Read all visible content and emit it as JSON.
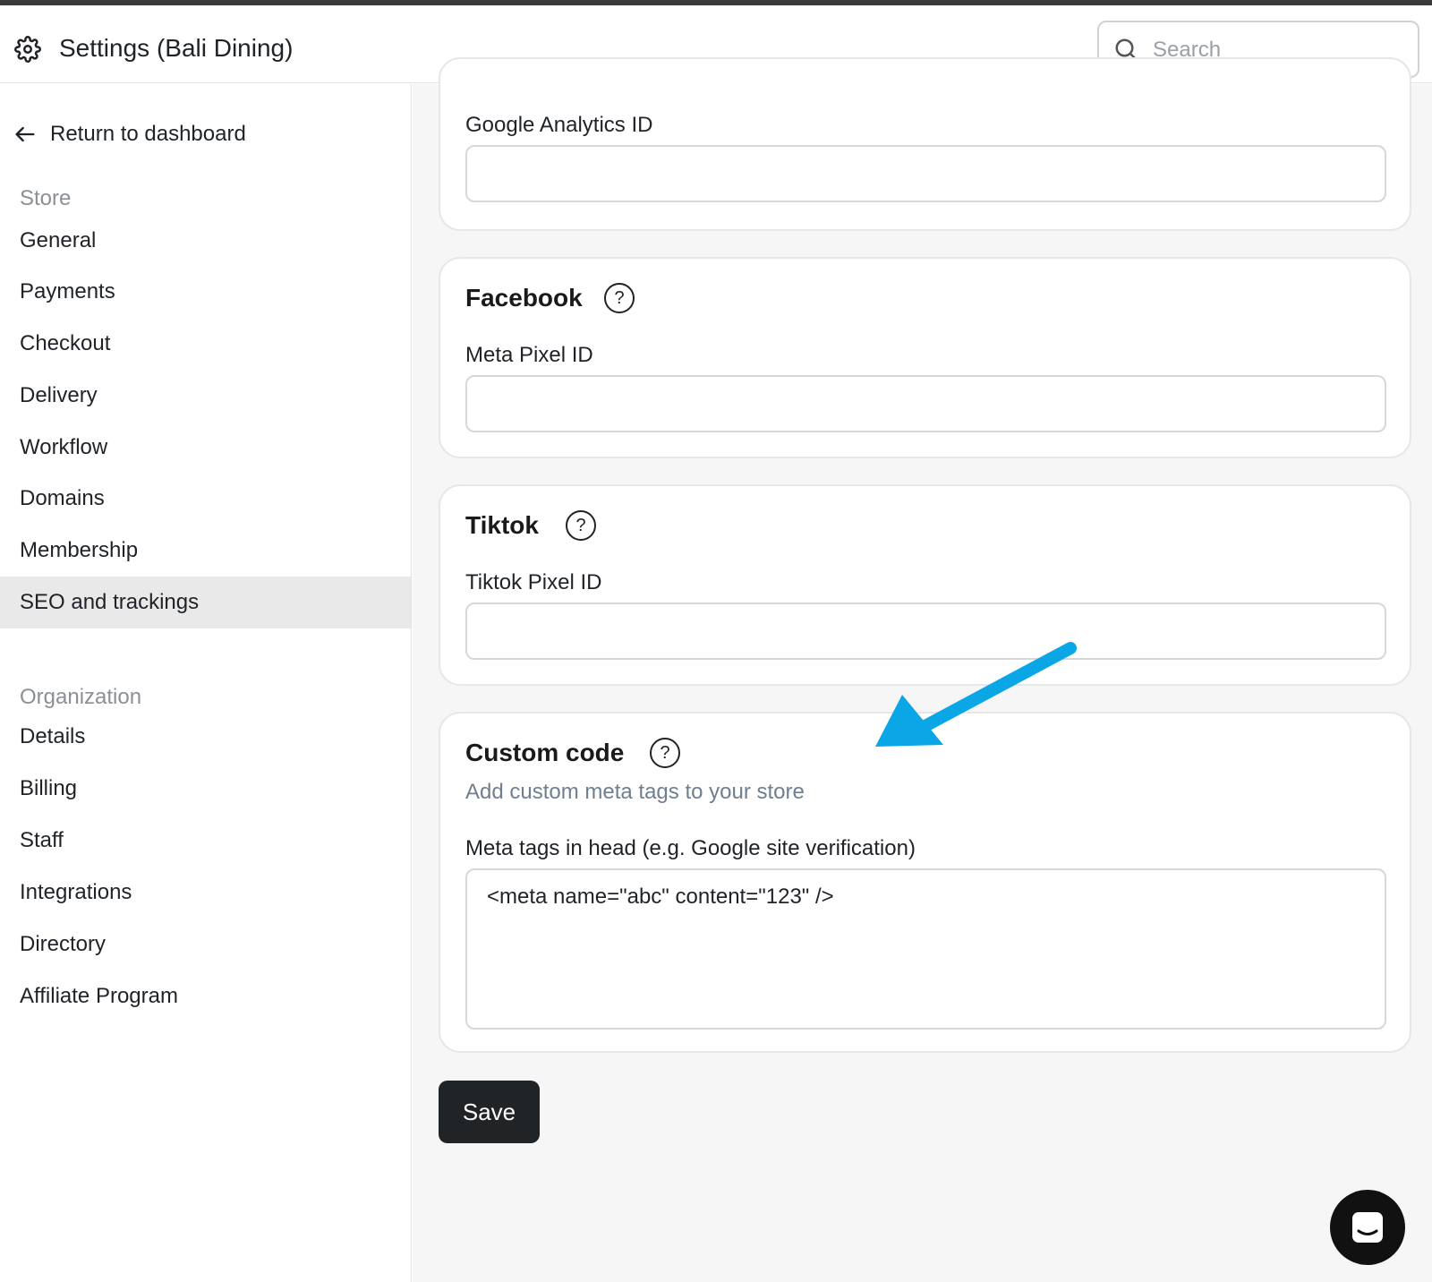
{
  "header": {
    "title": "Settings (Bali Dining)",
    "search_placeholder": "Search",
    "icon": "gear-icon"
  },
  "sidebar": {
    "back_label": "Return to dashboard",
    "store_title": "Store",
    "store_items": [
      "General",
      "Payments",
      "Checkout",
      "Delivery",
      "Workflow",
      "Domains",
      "Membership",
      "SEO and trackings"
    ],
    "active_item": "SEO and trackings",
    "org_title": "Organization",
    "org_items": [
      "Details",
      "Billing",
      "Staff",
      "Integrations",
      "Directory",
      "Affiliate Program"
    ]
  },
  "main": {
    "google": {
      "label": "Google Analytics ID",
      "value": ""
    },
    "facebook": {
      "title": "Facebook",
      "help": "?",
      "label": "Meta Pixel ID",
      "value": ""
    },
    "tiktok": {
      "title": "Tiktok",
      "help": "?",
      "label": "Tiktok Pixel ID",
      "value": ""
    },
    "custom": {
      "title": "Custom code",
      "help": "?",
      "description": "Add custom meta tags to your store",
      "label": "Meta tags in head (e.g. Google site verification)",
      "value": "<meta name=\"abc\" content=\"123\" />"
    },
    "save_label": "Save"
  },
  "colors": {
    "accent_arrow": "#0aa6e6",
    "save_bg": "#202427",
    "active_nav_bg": "#e9e9e9"
  }
}
